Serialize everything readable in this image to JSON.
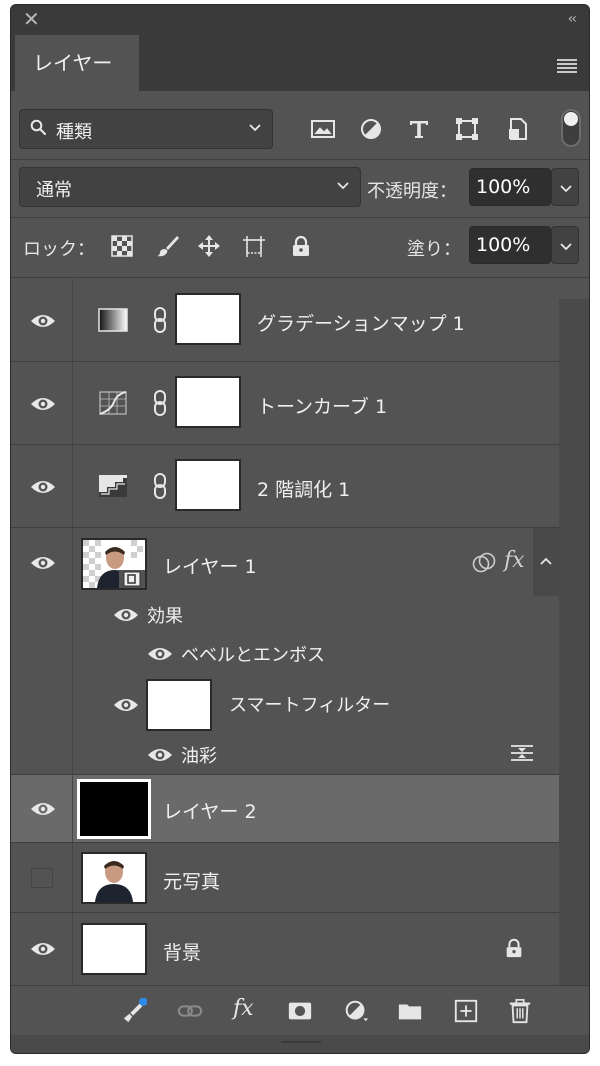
{
  "panel": {
    "tab_label": "レイヤー"
  },
  "filter": {
    "kind_label": "種類",
    "icons": [
      "image-filter-icon",
      "adjustment-filter-icon",
      "text-filter-icon",
      "shape-filter-icon",
      "smart-object-filter-icon"
    ]
  },
  "blend": {
    "mode": "通常",
    "opacity_label": "不透明度：",
    "opacity_value": "100%"
  },
  "lock": {
    "label": "ロック：",
    "icons": [
      "lock-transparent-pixels-icon",
      "lock-image-pixels-icon",
      "lock-position-icon",
      "lock-artboard-icon",
      "lock-all-icon"
    ],
    "fill_label": "塗り：",
    "fill_value": "100%"
  },
  "layers": [
    {
      "name": "グラデーションマップ 1",
      "type": "adjustment",
      "icon": "gradient-map-icon",
      "visible": true
    },
    {
      "name": "トーンカーブ 1",
      "type": "adjustment",
      "icon": "curves-icon",
      "visible": true
    },
    {
      "name": "2 階調化 1",
      "type": "adjustment",
      "icon": "threshold-icon",
      "visible": true
    },
    {
      "name": "レイヤー 1",
      "type": "smart-object",
      "visible": true,
      "effects_label": "効果",
      "effect_name": "ベベルとエンボス",
      "smart_filters_label": "スマートフィルター",
      "smart_filter_name": "油彩",
      "fx_label": "fx"
    },
    {
      "name": "レイヤー 2",
      "type": "pixel",
      "visible": true,
      "selected": true,
      "thumb_color": "#000000"
    },
    {
      "name": "元写真",
      "type": "pixel",
      "visible": false
    },
    {
      "name": "背景",
      "type": "background",
      "visible": true,
      "locked": true
    }
  ],
  "bottom_bar": {
    "icons": [
      "link-layers-icon",
      "layer-style-icon",
      "add-mask-icon",
      "new-adjustment-icon",
      "new-group-icon",
      "new-layer-icon",
      "delete-layer-icon"
    ],
    "fx_label": "fx"
  },
  "colors": {
    "panel_bg": "#535353",
    "selected_row": "#6a6a6a",
    "accent_dot": "#2d8ceb"
  }
}
